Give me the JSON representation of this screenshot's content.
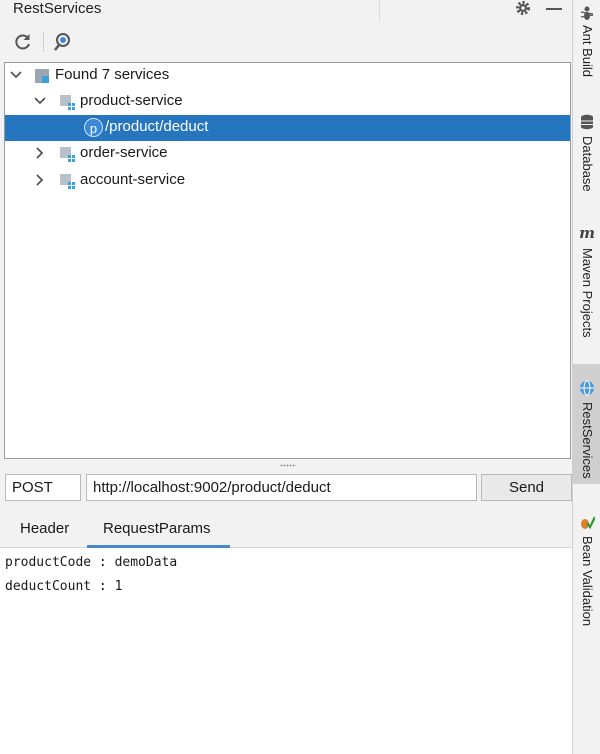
{
  "window": {
    "title": "RestServices"
  },
  "toolbar": {
    "refresh_icon": "refresh-icon",
    "search_icon": "search-icon"
  },
  "tree": {
    "root_label": "Found 7 services",
    "services": [
      {
        "label": "product-service",
        "expanded": true
      },
      {
        "label": "order-service",
        "expanded": false
      },
      {
        "label": "account-service",
        "expanded": false
      }
    ],
    "selected_endpoint": {
      "badge": "p",
      "label": "/product/deduct"
    }
  },
  "request": {
    "method": "POST",
    "url": "http://localhost:9002/product/deduct",
    "send_label": "Send"
  },
  "tabs": [
    {
      "label": "Header",
      "active": false
    },
    {
      "label": "RequestParams",
      "active": true
    }
  ],
  "params": [
    "productCode : demoData",
    "deductCount : 1"
  ],
  "side_tools": [
    {
      "label": "Ant Build",
      "icon": "ant-icon"
    },
    {
      "label": "Database",
      "icon": "database-icon"
    },
    {
      "label": "Maven Projects",
      "icon": "maven-icon"
    },
    {
      "label": "RestServices",
      "icon": "globe-icon",
      "active": true
    },
    {
      "label": "Bean Validation",
      "icon": "bean-icon"
    }
  ],
  "colors": {
    "selection": "#2675bf",
    "tab_underline": "#4a88c7",
    "badge": "#3b8ad9"
  }
}
